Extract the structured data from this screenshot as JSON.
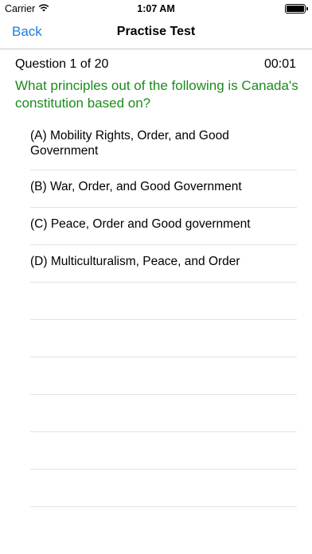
{
  "status_bar": {
    "carrier": "Carrier",
    "time": "1:07 AM",
    "wifi_icon": "wifi-icon",
    "battery_icon": "battery-icon"
  },
  "nav": {
    "back_label": "Back",
    "title": "Practise Test"
  },
  "question": {
    "counter": "Question 1 of 20",
    "timer": "00:01",
    "text": "What principles out of the following is Canada's constitution based on?",
    "text_color": "#1c8b1c"
  },
  "answers": [
    {
      "label": "(A) Mobility Rights, Order, and Good Government"
    },
    {
      "label": "(B) War, Order, and Good Government"
    },
    {
      "label": "(C) Peace, Order and Good government"
    },
    {
      "label": "(D) Multiculturalism, Peace, and Order"
    }
  ],
  "colors": {
    "accent": "#1e7ddb",
    "separator": "#e3e3e6"
  }
}
